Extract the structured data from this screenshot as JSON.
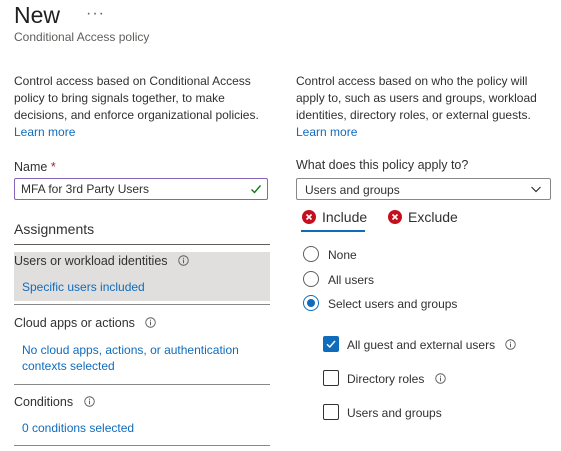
{
  "header": {
    "title": "New",
    "more_label": "···",
    "subtitle": "Conditional Access policy"
  },
  "left": {
    "description_lines": [
      "Control access based on Conditional Access",
      "policy to bring signals together, to make",
      "decisions, and enforce organizational policies."
    ],
    "learn_more": "Learn more",
    "name_label": "Name",
    "required_marker": "*",
    "name_value": "MFA for 3rd Party Users",
    "assignments_heading": "Assignments",
    "sections": [
      {
        "title": "Users or workload identities",
        "value_lines": [
          "Specific users included"
        ]
      },
      {
        "title": "Cloud apps or actions",
        "value_lines": [
          "No cloud apps, actions, or authentication",
          "contexts selected"
        ]
      },
      {
        "title": "Conditions",
        "value_lines": [
          "0 conditions selected"
        ]
      }
    ]
  },
  "right": {
    "description_lines": [
      "Control access based on who the policy will",
      "apply to, such as users and groups, workload",
      "identities, directory roles, or external guests."
    ],
    "learn_more": "Learn more",
    "applies_label": "What does this policy apply to?",
    "applies_value": "Users and groups",
    "tabs": [
      {
        "label": "Include",
        "selected": true
      },
      {
        "label": "Exclude",
        "selected": false
      }
    ],
    "radio_options": [
      {
        "label": "None",
        "selected": false
      },
      {
        "label": "All users",
        "selected": false
      },
      {
        "label": "Select users and groups",
        "selected": true
      }
    ],
    "checkbox_options": [
      {
        "label": "All guest and external users",
        "checked": true,
        "info": true
      },
      {
        "label": "Directory roles",
        "checked": false,
        "info": true
      },
      {
        "label": "Users and groups",
        "checked": false,
        "info": false
      }
    ]
  },
  "colors": {
    "accent": "#0f6cbd",
    "error_icon": "#c50f1f",
    "selected_row_bg": "#e1dfdd",
    "input_border": "#8764b8"
  }
}
